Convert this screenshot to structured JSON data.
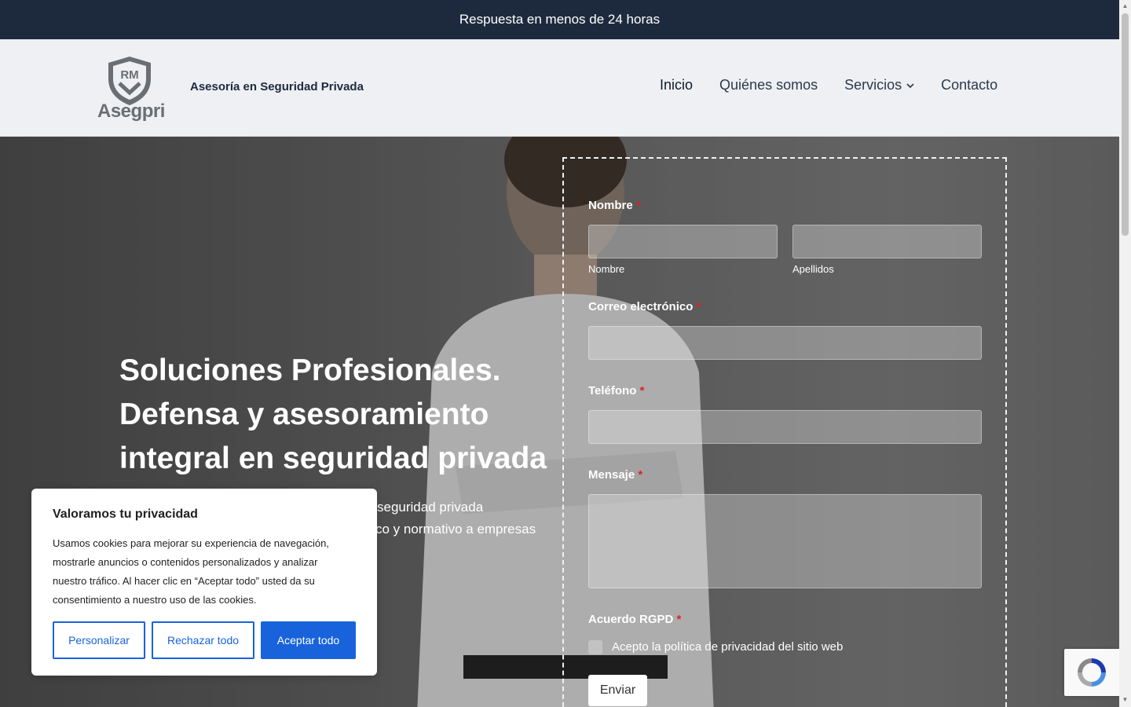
{
  "topbar": {
    "text": "Respuesta en menos de 24 horas"
  },
  "header": {
    "logo_monogram": "RM",
    "logo_text": "Asegpri",
    "tagline": "Asesoría en Seguridad Privada",
    "nav": [
      {
        "label": "Inicio"
      },
      {
        "label": "Quiénes somos"
      },
      {
        "label": "Servicios"
      },
      {
        "label": "Contacto"
      }
    ]
  },
  "hero": {
    "title_line1": "Soluciones Profesionales.",
    "title_line2": "Defensa y asesoramiento",
    "title_line3": "integral en seguridad privada",
    "sub_line1": "seguridad privada",
    "sub_line2": "co y normativo a empresas"
  },
  "form": {
    "name_label": "Nombre",
    "first_name_sublabel": "Nombre",
    "last_name_sublabel": "Apellidos",
    "email_label": "Correo electrónico",
    "phone_label": "Teléfono",
    "message_label": "Mensaje",
    "gdpr_label": "Acuerdo RGPD",
    "gdpr_checkbox_text": "Acepto la política de privacidad del sitio web",
    "required_mark": "*",
    "submit_label": "Enviar"
  },
  "cookie": {
    "title": "Valoramos tu privacidad",
    "text": "Usamos cookies para mejorar su experiencia de navegación, mostrarle anuncios o contenidos personalizados y analizar nuestro tráfico. Al hacer clic en “Aceptar todo” usted da su consentimiento a nuestro uso de las cookies.",
    "customize_label": "Personalizar",
    "reject_label": "Rechazar todo",
    "accept_label": "Aceptar todo"
  },
  "colors": {
    "topbar": "#1d2a3e",
    "accent": "#1863dc",
    "required": "#e02020"
  }
}
